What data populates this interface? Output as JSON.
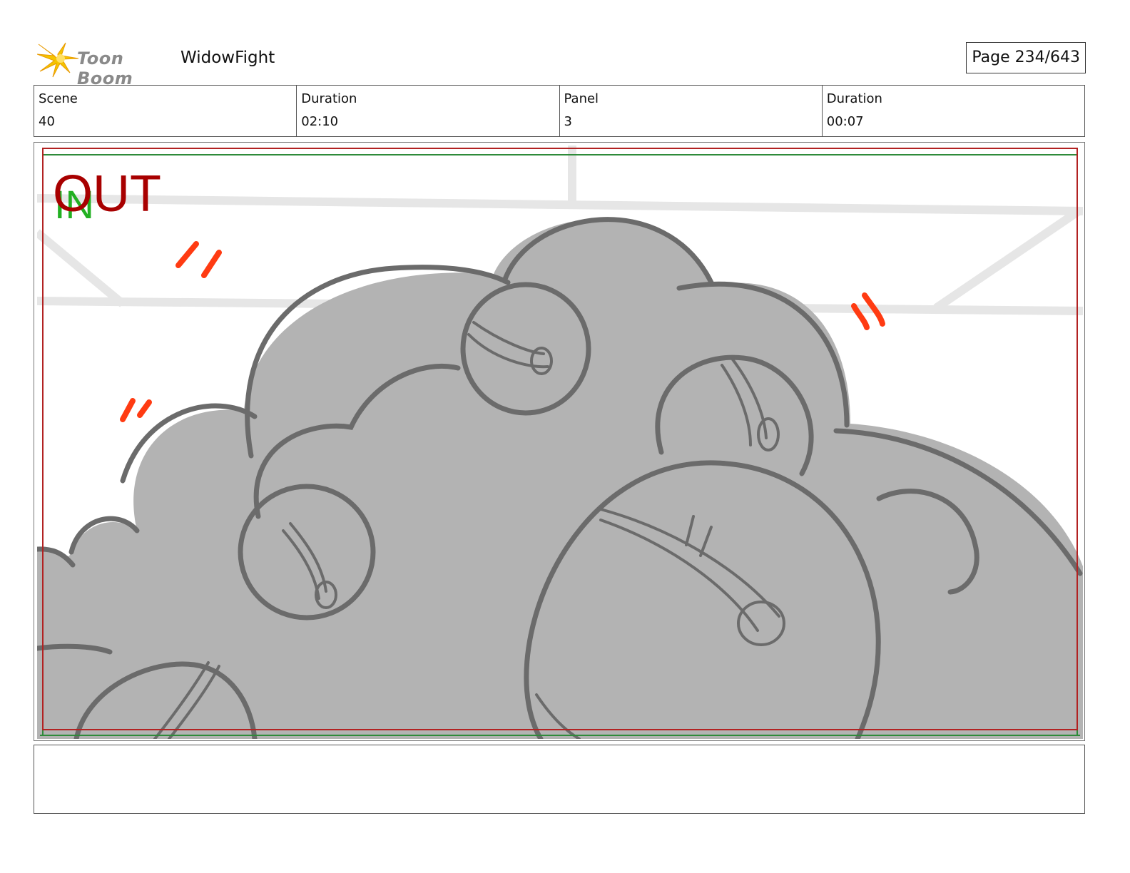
{
  "header": {
    "brand": "Toon Boom",
    "project_title": "WidowFight",
    "page_label": "Page 234/643"
  },
  "info": [
    {
      "label": "Scene",
      "value": "40"
    },
    {
      "label": "Duration",
      "value": "02:10"
    },
    {
      "label": "Panel",
      "value": "3"
    },
    {
      "label": "Duration",
      "value": "00:07"
    }
  ],
  "panel": {
    "overlay_out": "OUT",
    "overlay_in": "IN",
    "colors": {
      "frame_red": "#b22222",
      "frame_green": "#2e8b3a",
      "smoke_fill": "#b3b3b3",
      "smoke_line": "#6b6b6b",
      "accent_orange": "#ff3b12"
    }
  },
  "notes": {
    "text": ""
  }
}
